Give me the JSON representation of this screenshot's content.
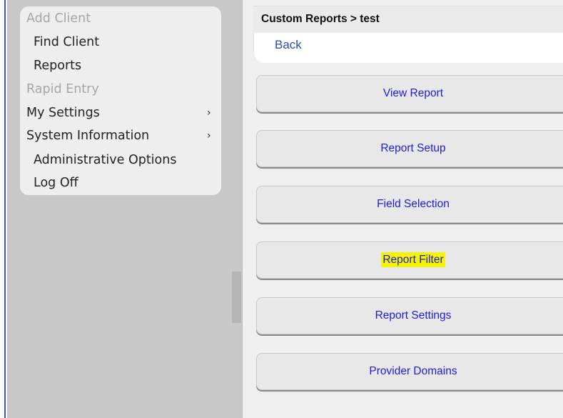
{
  "sidebar": {
    "items": [
      {
        "label": "Add Client",
        "disabled": true,
        "indent": false
      },
      {
        "label": "Find Client",
        "disabled": false,
        "indent": true
      },
      {
        "label": "Reports",
        "disabled": false,
        "indent": true
      },
      {
        "label": "Rapid Entry",
        "disabled": true,
        "indent": false
      },
      {
        "label": "My Settings",
        "disabled": false,
        "indent": false,
        "submenu": true
      },
      {
        "label": "System Information",
        "disabled": false,
        "indent": false,
        "submenu": true
      },
      {
        "label": "Administrative Options",
        "disabled": false,
        "indent": true
      },
      {
        "label": "Log Off",
        "disabled": false,
        "indent": true
      }
    ],
    "chevron": "›"
  },
  "header": {
    "breadcrumb": "Custom Reports > test",
    "back_label": "Back"
  },
  "actions": [
    {
      "label": "View Report",
      "highlighted": false
    },
    {
      "label": "Report Setup",
      "highlighted": false
    },
    {
      "label": "Field Selection",
      "highlighted": false
    },
    {
      "label": "Report Filter",
      "highlighted": true
    },
    {
      "label": "Report Settings",
      "highlighted": false
    },
    {
      "label": "Provider Domains",
      "highlighted": false
    }
  ],
  "colors": {
    "link": "#1c1cd8",
    "highlight": "#f4f400",
    "disabled_text": "#a6a6a6"
  }
}
